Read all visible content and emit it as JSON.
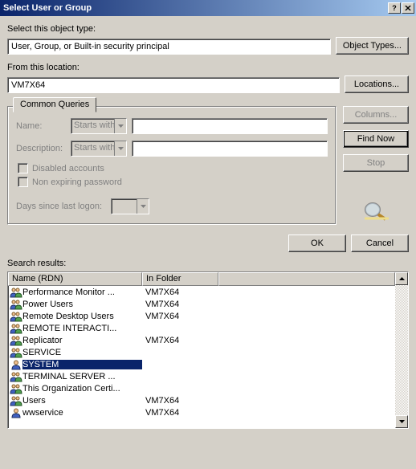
{
  "window": {
    "title": "Select User or Group",
    "help_label": "?",
    "close_label": "×"
  },
  "object_type": {
    "label": "Select this object type:",
    "value": "User, Group, or Built-in security principal",
    "button": "Object Types..."
  },
  "location": {
    "label": "From this location:",
    "value": "VM7X64",
    "button": "Locations..."
  },
  "tab": {
    "label": "Common Queries"
  },
  "query": {
    "name_label": "Name:",
    "name_combo": "Starts with",
    "desc_label": "Description:",
    "desc_combo": "Starts with",
    "disabled_label": "Disabled accounts",
    "nonexp_label": "Non expiring password",
    "days_label": "Days since last logon:"
  },
  "side_buttons": {
    "columns": "Columns...",
    "find": "Find Now",
    "stop": "Stop"
  },
  "actions": {
    "ok": "OK",
    "cancel": "Cancel"
  },
  "results": {
    "label": "Search results:",
    "col_name": "Name (RDN)",
    "col_folder": "In Folder",
    "rows": [
      {
        "name": "Performance Monitor ...",
        "folder": "VM7X64",
        "icon": "group"
      },
      {
        "name": "Power Users",
        "folder": "VM7X64",
        "icon": "group"
      },
      {
        "name": "Remote Desktop Users",
        "folder": "VM7X64",
        "icon": "group"
      },
      {
        "name": "REMOTE INTERACTI...",
        "folder": "",
        "icon": "group"
      },
      {
        "name": "Replicator",
        "folder": "VM7X64",
        "icon": "group"
      },
      {
        "name": "SERVICE",
        "folder": "",
        "icon": "group"
      },
      {
        "name": "SYSTEM",
        "folder": "",
        "icon": "user",
        "selected": true
      },
      {
        "name": "TERMINAL SERVER ...",
        "folder": "",
        "icon": "group"
      },
      {
        "name": "This Organization Certi...",
        "folder": "",
        "icon": "group"
      },
      {
        "name": "Users",
        "folder": "VM7X64",
        "icon": "group"
      },
      {
        "name": "wwservice",
        "folder": "VM7X64",
        "icon": "user"
      }
    ]
  }
}
